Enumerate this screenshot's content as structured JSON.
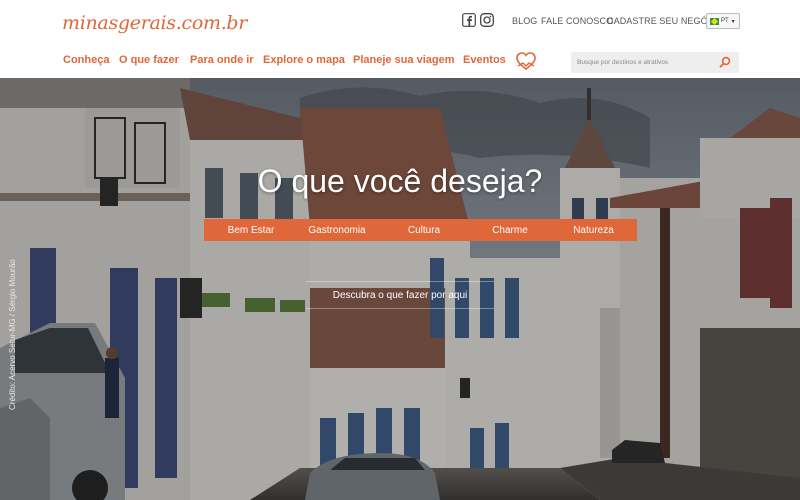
{
  "brand": {
    "logo_text": "minasgerais.com.br",
    "accent": "#e0673a"
  },
  "social": {
    "facebook_icon": "facebook-icon",
    "instagram_icon": "instagram-icon"
  },
  "top_links": [
    "BLOG",
    "FALE CONOSCO",
    "CADASTRE SEU NEGÓCIO"
  ],
  "language": {
    "selected": "PT",
    "flag_icon": "brazil-flag-icon"
  },
  "nav": [
    "Conheça",
    "O que fazer",
    "Para onde ir",
    "Explore o mapa",
    "Planeje sua viagem",
    "Eventos"
  ],
  "nav_extra_icon": "heart-map-icon",
  "search": {
    "placeholder": "Busque por destinos e atrativos",
    "value": ""
  },
  "hero": {
    "title": "O que você deseja?",
    "categories": [
      "Bem Estar",
      "Gastronomia",
      "Cultura",
      "Charme",
      "Natureza"
    ],
    "discover_label": "Descubra o que fazer por aqui",
    "credit": "Crédito: Acervo Setur-MG / Sérgio Mourão"
  }
}
